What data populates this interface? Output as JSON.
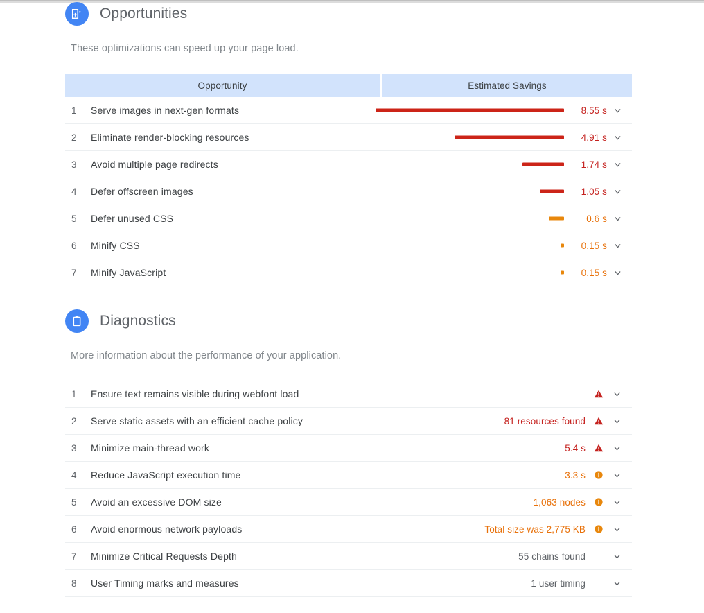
{
  "opportunities": {
    "icon": "document-sparkle-icon",
    "title": "Opportunities",
    "description": "These optimizations can speed up your page load.",
    "columns": {
      "name": "Opportunity",
      "savings": "Estimated Savings"
    },
    "rows": [
      {
        "index": "1",
        "title": "Serve images in next-gen formats",
        "value": "8.55 s",
        "severity": "red",
        "bar_pct": 100
      },
      {
        "index": "2",
        "title": "Eliminate render-blocking resources",
        "value": "4.91 s",
        "severity": "red",
        "bar_pct": 58
      },
      {
        "index": "3",
        "title": "Avoid multiple page redirects",
        "value": "1.74 s",
        "severity": "red",
        "bar_pct": 22
      },
      {
        "index": "4",
        "title": "Defer offscreen images",
        "value": "1.05 s",
        "severity": "red",
        "bar_pct": 13
      },
      {
        "index": "5",
        "title": "Defer unused CSS",
        "value": "0.6 s",
        "severity": "orange",
        "bar_pct": 8
      },
      {
        "index": "6",
        "title": "Minify CSS",
        "value": "0.15 s",
        "severity": "orange",
        "bar_pct": 2
      },
      {
        "index": "7",
        "title": "Minify JavaScript",
        "value": "0.15 s",
        "severity": "orange",
        "bar_pct": 2
      }
    ]
  },
  "diagnostics": {
    "icon": "clipboard-icon",
    "title": "Diagnostics",
    "description": "More information about the performance of your application.",
    "rows": [
      {
        "index": "1",
        "title": "Ensure text remains visible during webfont load",
        "value": "",
        "severity": "red"
      },
      {
        "index": "2",
        "title": "Serve static assets with an efficient cache policy",
        "value": "81 resources found",
        "severity": "red"
      },
      {
        "index": "3",
        "title": "Minimize main-thread work",
        "value": "5.4 s",
        "severity": "red"
      },
      {
        "index": "4",
        "title": "Reduce JavaScript execution time",
        "value": "3.3 s",
        "severity": "orange"
      },
      {
        "index": "5",
        "title": "Avoid an excessive DOM size",
        "value": "1,063 nodes",
        "severity": "orange"
      },
      {
        "index": "6",
        "title": "Avoid enormous network payloads",
        "value": "Total size was 2,775 KB",
        "severity": "orange"
      },
      {
        "index": "7",
        "title": "Minimize Critical Requests Depth",
        "value": "55 chains found",
        "severity": "none"
      },
      {
        "index": "8",
        "title": "User Timing marks and measures",
        "value": "1 user timing",
        "severity": "none"
      }
    ]
  },
  "colors": {
    "red": "#c5221f",
    "red_bar": "#cc2418",
    "orange": "#e8710a",
    "orange_bar": "#e8870c",
    "gray": "#5f6368",
    "accent_blue": "#4285F4",
    "header_blue": "#d2e3fc"
  }
}
